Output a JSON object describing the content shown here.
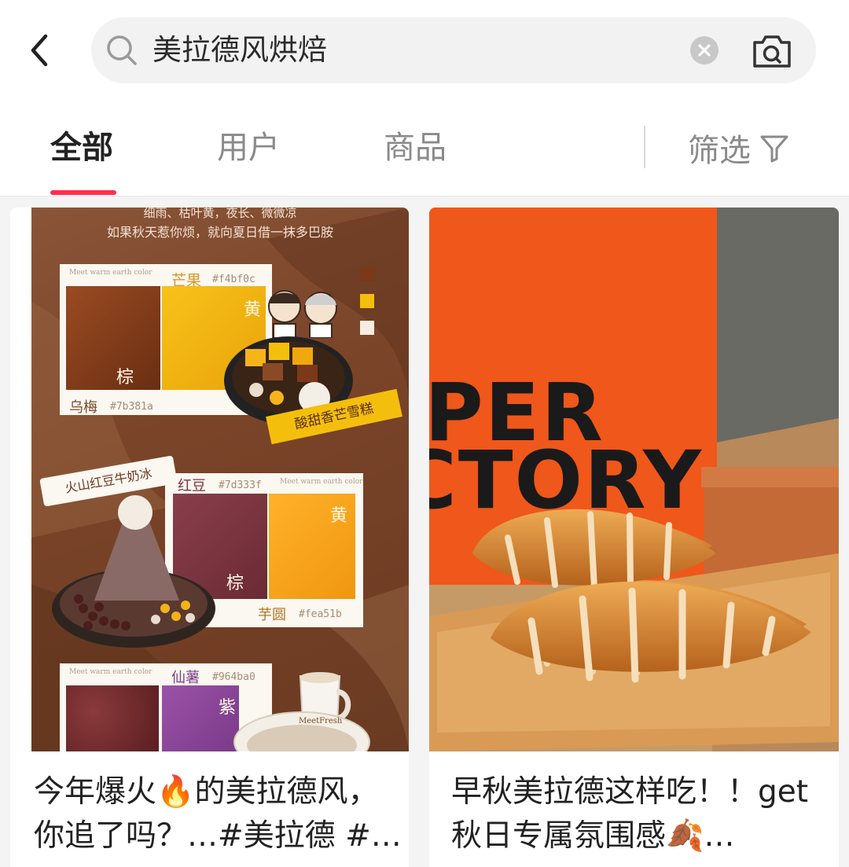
{
  "search": {
    "query": "美拉德风烘焙"
  },
  "tabs": [
    {
      "label": "全部",
      "active": true
    },
    {
      "label": "用户",
      "active": false
    },
    {
      "label": "商品",
      "active": false
    }
  ],
  "filter": {
    "label": "筛选"
  },
  "colors": {
    "accent": "#ff2e4d",
    "tab_inactive": "#8a8a8a"
  },
  "feed": [
    {
      "title": "今年爆火🔥的美拉德风，你追了吗？…#美拉德 #…",
      "image": {
        "caption_line1": "细雨、枯叶黄，夜长、微微凉",
        "caption_line2": "如果秋天惹你烦，就向夏日借一抹多巴胺",
        "panel_tag": "Meet warm earth color",
        "swatches": [
          {
            "name": "乌梅",
            "hex": "#7b381a",
            "char": "棕"
          },
          {
            "name": "芒果",
            "hex": "#f4bf0c",
            "char": "黄"
          },
          {
            "name": "红豆",
            "hex": "#7d333f",
            "char": "棕"
          },
          {
            "name": "芋圆",
            "hex": "#fea51b",
            "char": "黄"
          },
          {
            "name": "仙薯",
            "hex": "#964ba0",
            "char": "紫"
          }
        ],
        "dish1": "酸甜香芒雪糕",
        "dish2": "火山红豆牛奶冰",
        "cup_logo": "MeetFresh"
      }
    },
    {
      "title": "早秋美拉德这样吃！！get秋日专属氛围感🍂…",
      "image": {
        "box_text_line1": "PER",
        "box_text_line2": "CTORY"
      }
    }
  ]
}
